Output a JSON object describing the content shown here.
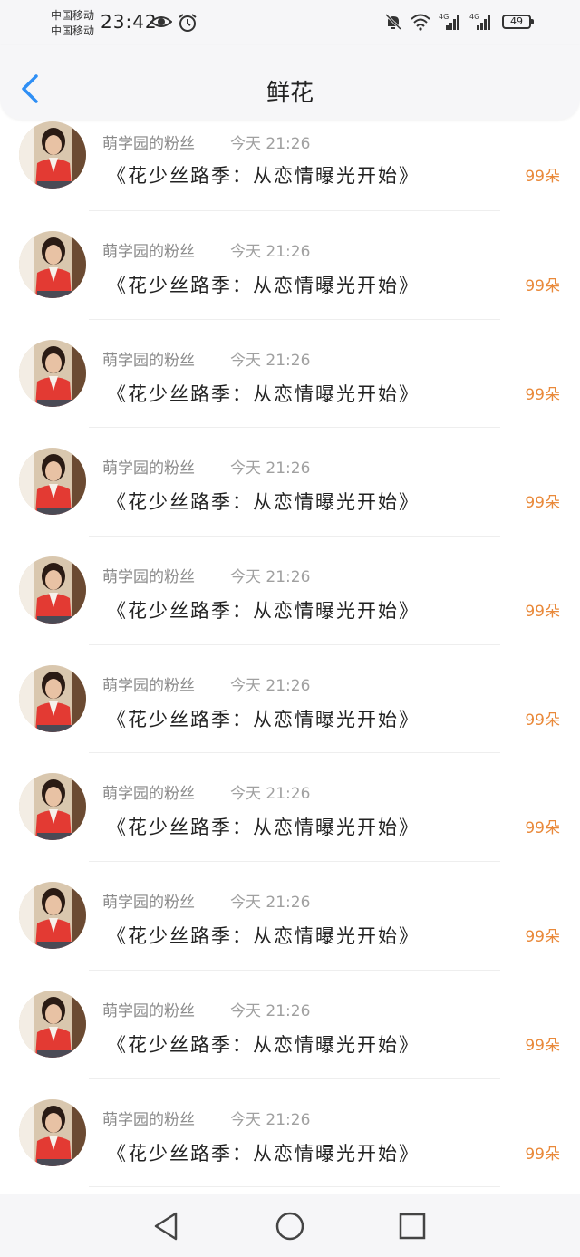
{
  "status_bar": {
    "carrier_1": "中国移动",
    "carrier_2": "中国移动",
    "time": "23:42",
    "battery": "49",
    "network_1": "4G",
    "network_2": "4G",
    "icons": [
      "eye-icon",
      "alarm-icon",
      "mute-bell-icon",
      "wifi-icon",
      "signal-icon",
      "signal-icon",
      "battery-icon"
    ]
  },
  "header": {
    "title": "鲜花",
    "back_icon": "chevron-left-icon"
  },
  "gifts": [
    {
      "sender": "萌学园的粉丝",
      "time": "今天 21:26",
      "title": "《花少丝路季：从恋情曝光开始》",
      "count": "99朵"
    },
    {
      "sender": "萌学园的粉丝",
      "time": "今天 21:26",
      "title": "《花少丝路季：从恋情曝光开始》",
      "count": "99朵"
    },
    {
      "sender": "萌学园的粉丝",
      "time": "今天 21:26",
      "title": "《花少丝路季：从恋情曝光开始》",
      "count": "99朵"
    },
    {
      "sender": "萌学园的粉丝",
      "time": "今天 21:26",
      "title": "《花少丝路季：从恋情曝光开始》",
      "count": "99朵"
    },
    {
      "sender": "萌学园的粉丝",
      "time": "今天 21:26",
      "title": "《花少丝路季：从恋情曝光开始》",
      "count": "99朵"
    },
    {
      "sender": "萌学园的粉丝",
      "time": "今天 21:26",
      "title": "《花少丝路季：从恋情曝光开始》",
      "count": "99朵"
    },
    {
      "sender": "萌学园的粉丝",
      "time": "今天 21:26",
      "title": "《花少丝路季：从恋情曝光开始》",
      "count": "99朵"
    },
    {
      "sender": "萌学园的粉丝",
      "time": "今天 21:26",
      "title": "《花少丝路季：从恋情曝光开始》",
      "count": "99朵"
    },
    {
      "sender": "萌学园的粉丝",
      "time": "今天 21:26",
      "title": "《花少丝路季：从恋情曝光开始》",
      "count": "99朵"
    },
    {
      "sender": "萌学园的粉丝",
      "time": "今天 21:26",
      "title": "《花少丝路季：从恋情曝光开始》",
      "count": "99朵"
    }
  ],
  "nav_bar": {
    "icons": [
      "back-triangle-icon",
      "home-circle-icon",
      "recents-square-icon"
    ]
  },
  "colors": {
    "accent_blue": "#2f8ff5",
    "count_orange": "#e9893a",
    "header_bg": "#f6f6f8"
  }
}
